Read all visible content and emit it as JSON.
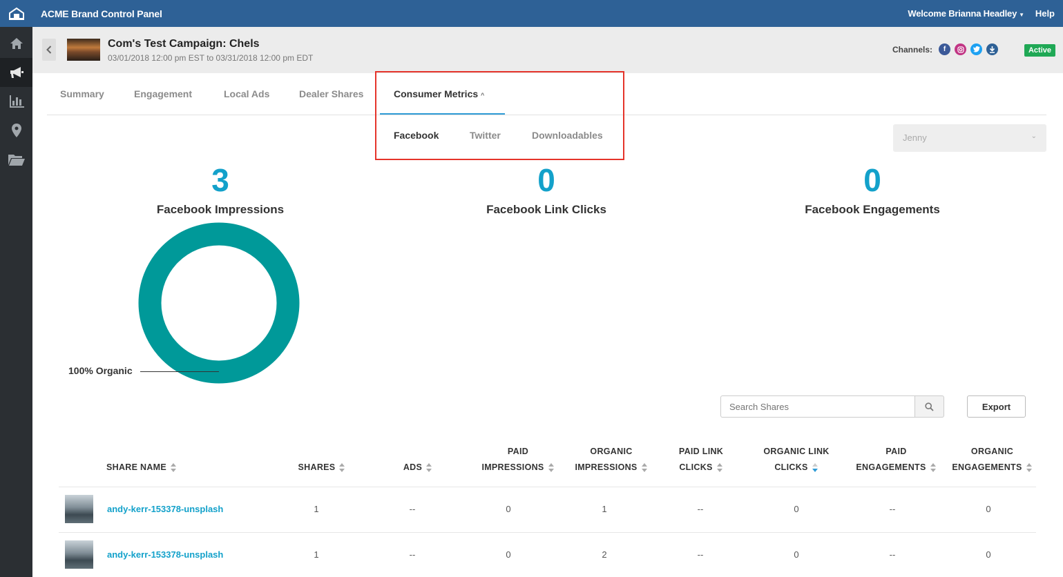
{
  "app": {
    "title": "ACME Brand Control Panel",
    "welcome": "Welcome Brianna Headley",
    "help": "Help"
  },
  "sidebar": {
    "items": [
      {
        "icon": "home-icon"
      },
      {
        "icon": "megaphone-icon"
      },
      {
        "icon": "bar-chart-icon"
      },
      {
        "icon": "map-pin-icon"
      },
      {
        "icon": "folder-icon"
      }
    ]
  },
  "campaign": {
    "title": "Com's Test Campaign: Chels",
    "dates": "03/01/2018 12:00 pm EST to 03/31/2018 12:00 pm EDT",
    "channels_label": "Channels:",
    "status": "Active",
    "channel_colors": {
      "facebook": "#3b5998",
      "instagram": "#c13584",
      "twitter": "#1da1f2",
      "download": "#2e6196"
    }
  },
  "tabs": [
    "Summary",
    "Engagement",
    "Local Ads",
    "Dealer Shares",
    "Consumer Metrics"
  ],
  "subtabs": [
    "Facebook",
    "Twitter",
    "Downloadables"
  ],
  "filter": {
    "selected": "Jenny"
  },
  "metrics": [
    {
      "value": "3",
      "label": "Facebook Impressions"
    },
    {
      "value": "0",
      "label": "Facebook Link Clicks"
    },
    {
      "value": "0",
      "label": "Facebook Engagements"
    }
  ],
  "donut": {
    "label": "100% Organic",
    "organic_fraction": 1.0,
    "color": "#009999"
  },
  "search": {
    "placeholder": "Search Shares"
  },
  "export_label": "Export",
  "table": {
    "headers": [
      [
        "SHARE NAME"
      ],
      [
        "SHARES"
      ],
      [
        "ADS"
      ],
      [
        "PAID",
        "IMPRESSIONS"
      ],
      [
        "ORGANIC",
        "IMPRESSIONS"
      ],
      [
        "PAID LINK",
        "CLICKS"
      ],
      [
        "ORGANIC LINK",
        "CLICKS"
      ],
      [
        "PAID",
        "ENGAGEMENTS"
      ],
      [
        "ORGANIC",
        "ENGAGEMENTS"
      ]
    ],
    "rows": [
      {
        "name": "andy-kerr-153378-unsplash",
        "cells": [
          "1",
          "--",
          "0",
          "1",
          "--",
          "0",
          "--",
          "0"
        ]
      },
      {
        "name": "andy-kerr-153378-unsplash",
        "cells": [
          "1",
          "--",
          "0",
          "2",
          "--",
          "0",
          "--",
          "0"
        ]
      }
    ]
  }
}
